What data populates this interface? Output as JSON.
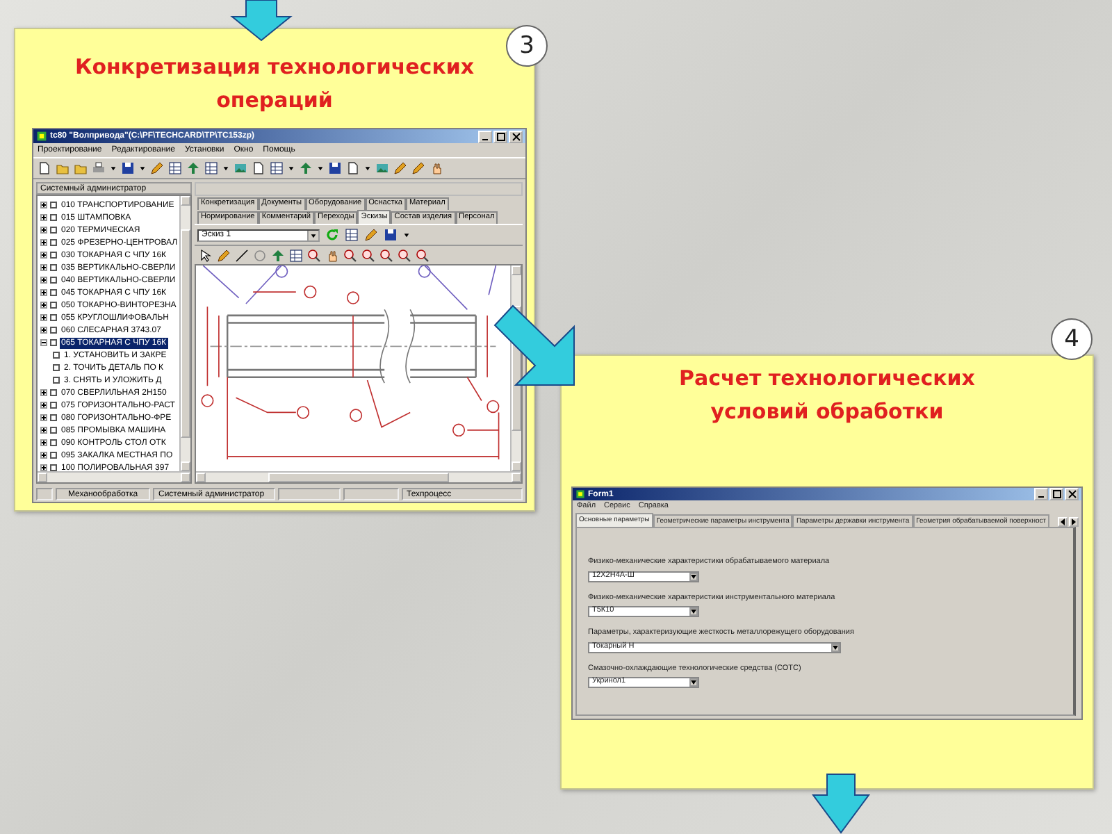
{
  "step3": {
    "badge": "3",
    "title": "Конкретизация технологических операций",
    "app": {
      "title": "tc80 \"Волпривода\"(C:\\PF\\TECHCARD\\TP\\TC153zp)",
      "menu": [
        "Проектирование",
        "Редактирование",
        "Установки",
        "Окно",
        "Помощь"
      ],
      "user_panel": "Системный администратор",
      "tree": [
        {
          "label": "010 ТРАНСПОРТИРОВАНИЕ",
          "checked": false,
          "selected": false,
          "expanded": false
        },
        {
          "label": "015 ШТАМПОВКА",
          "checked": false,
          "selected": false,
          "expanded": false
        },
        {
          "label": "020 ТЕРМИЧЕСКАЯ",
          "checked": false,
          "selected": false,
          "expanded": false
        },
        {
          "label": "025 ФРЕЗЕРНО-ЦЕНТРОВАЛ",
          "checked": false,
          "selected": false,
          "expanded": false
        },
        {
          "label": "030 ТОКАРНАЯ С ЧПУ 16К",
          "checked": false,
          "selected": false,
          "expanded": false
        },
        {
          "label": "035 ВЕРТИКАЛЬНО-СВЕРЛИ",
          "checked": false,
          "selected": false,
          "expanded": false
        },
        {
          "label": "040 ВЕРТИКАЛЬНО-СВЕРЛИ",
          "checked": false,
          "selected": false,
          "expanded": false
        },
        {
          "label": "045 ТОКАРНАЯ С ЧПУ 16К",
          "checked": false,
          "selected": false,
          "expanded": false
        },
        {
          "label": "050 ТОКАРНО-ВИНТОРЕЗНА",
          "checked": false,
          "selected": false,
          "expanded": false
        },
        {
          "label": "055 КРУГЛОШЛИФОВАЛЬН",
          "checked": false,
          "selected": false,
          "expanded": false
        },
        {
          "label": "060 СЛЕСАРНАЯ 3743.07",
          "checked": false,
          "selected": false,
          "expanded": false
        },
        {
          "label": "065 ТОКАРНАЯ С ЧПУ 16К",
          "checked": false,
          "selected": true,
          "expanded": true,
          "children": [
            {
              "label": "1. УСТАНОВИТЬ И ЗАКРЕ",
              "checked": false,
              "selected": false
            },
            {
              "label": "2. ТОЧИТЬ ДЕТАЛЬ ПО К",
              "checked": false,
              "selected": false
            },
            {
              "label": "3. СНЯТЬ И УЛОЖИТЬ Д",
              "checked": false,
              "selected": false
            }
          ]
        },
        {
          "label": "070 СВЕРЛИЛЬНАЯ 2Н150",
          "checked": false,
          "selected": false,
          "expanded": false
        },
        {
          "label": "075 ГОРИЗОНТАЛЬНО-РАСТ",
          "checked": false,
          "selected": false,
          "expanded": false
        },
        {
          "label": "080 ГОРИЗОНТАЛЬНО-ФРЕ",
          "checked": false,
          "selected": false,
          "expanded": false
        },
        {
          "label": "085 ПРОМЫВКА МАШИНА",
          "checked": false,
          "selected": false,
          "expanded": false
        },
        {
          "label": "090 КОНТРОЛЬ СТОЛ ОТК",
          "checked": false,
          "selected": false,
          "expanded": false
        },
        {
          "label": "095 ЗАКАЛКА МЕСТНАЯ ПО",
          "checked": false,
          "selected": false,
          "expanded": false
        },
        {
          "label": "100 ПОЛИРОВАЛЬНАЯ 397",
          "checked": false,
          "selected": false,
          "expanded": false
        }
      ],
      "tab_rows": [
        {
          "tabs": [
            {
              "label": "Конкретизация",
              "selected": false
            },
            {
              "label": "Документы",
              "selected": false
            },
            {
              "label": "Оборудование",
              "selected": false
            },
            {
              "label": "Оснастка",
              "selected": false
            },
            {
              "label": "Материал",
              "selected": false
            }
          ]
        },
        {
          "tabs": [
            {
              "label": "Нормирование",
              "selected": false
            },
            {
              "label": "Комментарий",
              "selected": false
            },
            {
              "label": "Переходы",
              "selected": false
            },
            {
              "label": "Эскизы",
              "selected": true
            },
            {
              "label": "Состав изделия",
              "selected": false
            },
            {
              "label": "Персонал",
              "selected": false
            }
          ]
        }
      ],
      "sketch_select": "Эскиз 1",
      "status_bar": [
        "Механообработка",
        "Системный администратор",
        "Техпроцесс"
      ]
    }
  },
  "step4": {
    "badge": "4",
    "title": "Расчет технологических условий обработки",
    "form": {
      "title": "Form1",
      "menu": [
        "Файл",
        "Сервис",
        "Справка"
      ],
      "tabs": [
        {
          "label": "Основные параметры",
          "selected": true
        },
        {
          "label": "Геометрические параметры инструмента",
          "selected": false
        },
        {
          "label": "Параметры державки инструмента",
          "selected": false
        },
        {
          "label": "Геометрия обрабатываемой поверхност",
          "selected": false
        }
      ],
      "fields": [
        {
          "label": "Физико-механические характеристики обрабатываемого материала",
          "value": "12Х2Н4А-Ш",
          "kind": "short"
        },
        {
          "label": "Физико-механические характеристики инструментального материала",
          "value": "Т5К10",
          "kind": "short"
        },
        {
          "label": "Параметры, характеризующие жесткость металлорежущего оборудования",
          "value": "Токарный Н",
          "kind": "wide"
        },
        {
          "label": "Смазочно-охлаждающие технологические средства (СОТС)",
          "value": "Укринол1",
          "kind": "short"
        }
      ]
    }
  }
}
